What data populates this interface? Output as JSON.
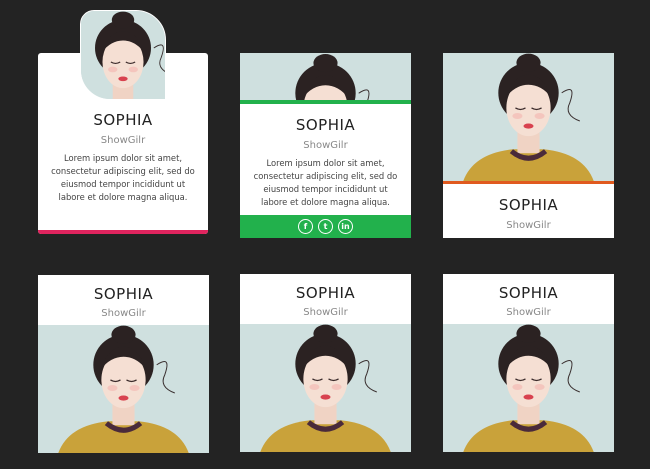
{
  "cards": [
    {
      "name": "SOPHIA",
      "role": "ShowGilr",
      "description": "Lorem ipsum dolor sit amet, consectetur adipiscing elit, sed do eiusmod tempor incididunt ut labore et dolore magna aliqua.",
      "accent": "#e0245e"
    },
    {
      "name": "SOPHIA",
      "role": "ShowGilr",
      "description": "Lorem ipsum dolor sit amet, consectetur adipiscing elit, sed do eiusmod tempor incididunt ut labore et dolore magna aliqua.",
      "accent": "#22b14c",
      "social": [
        {
          "icon": "facebook-icon",
          "glyph": "f"
        },
        {
          "icon": "twitter-icon",
          "glyph": "t"
        },
        {
          "icon": "linkedin-icon",
          "glyph": "in"
        }
      ]
    },
    {
      "name": "SOPHIA",
      "role": "ShowGilr",
      "accent": "#e05a1f"
    },
    {
      "name": "SOPHIA",
      "role": "ShowGilr"
    },
    {
      "name": "SOPHIA",
      "role": "ShowGilr"
    },
    {
      "name": "SOPHIA",
      "role": "ShowGilr"
    }
  ],
  "colors": {
    "background": "#232323",
    "card": "#ffffff",
    "photo_bg": "#cfdfdf"
  }
}
